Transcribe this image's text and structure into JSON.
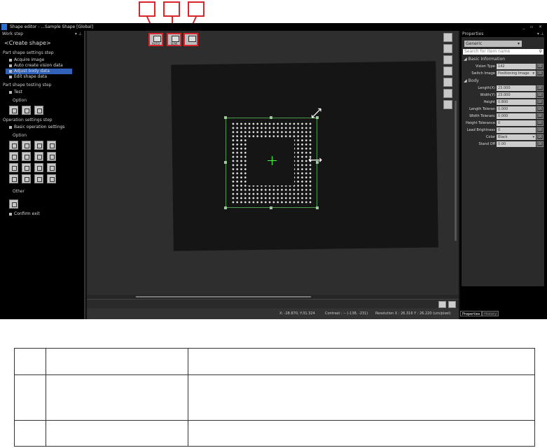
{
  "window": {
    "title": "Shape editor - ...Sample Shape [Global]"
  },
  "left_panel": {
    "header": "Work step",
    "heading": "<Create shape>",
    "sections": [
      {
        "title": "Part shape settings step",
        "items": [
          "Acquire image",
          "Auto create vision data",
          "Adjust body data",
          "Edit shape data"
        ],
        "selected": "Adjust body data"
      },
      {
        "title": "Part shape testing step",
        "items": [
          "Test"
        ],
        "option": "Option"
      },
      {
        "title": "Operation settings step",
        "items": [
          "Basic operation settings"
        ],
        "option": "Option"
      }
    ],
    "other": "Other",
    "confirm": "Confirm exit"
  },
  "toolbar": {
    "buttons": [
      "AUTO",
      "SEMI AUTO",
      ""
    ]
  },
  "status": {
    "coords": "X: -28.870, Y:31.324",
    "contrast": "Contrast : -- (-138, -231)",
    "resolution": "Resolution X : 26.316   Y : 26.220 (um/pixel)"
  },
  "properties": {
    "header": "Properties",
    "category": "Generic",
    "search_placeholder": "Search for item name",
    "groups": [
      {
        "name": "Basic Information",
        "rows": [
          {
            "label": "Vision Type",
            "value": "142"
          },
          {
            "label": "Switch Image",
            "value": "Positioning Image",
            "dropdown": true
          }
        ]
      },
      {
        "name": "Body",
        "rows": [
          {
            "label": "Length(X)",
            "value": "23.000"
          },
          {
            "label": "Width(Y)",
            "value": "23.000"
          },
          {
            "label": "Height",
            "value": "0.800"
          },
          {
            "label": "Length Toleran",
            "value": "0.000"
          },
          {
            "label": "Width Toleranc",
            "value": "0.000"
          },
          {
            "label": "Height Tolerance",
            "value": "0"
          },
          {
            "label": "Lead Brightness",
            "value": "0"
          },
          {
            "label": "Color",
            "value": "Black",
            "dropdown": true
          },
          {
            "label": "Stand Off",
            "value": "0.00"
          }
        ]
      }
    ],
    "or_label": "OR",
    "tabs": [
      "Properties",
      "History"
    ]
  }
}
